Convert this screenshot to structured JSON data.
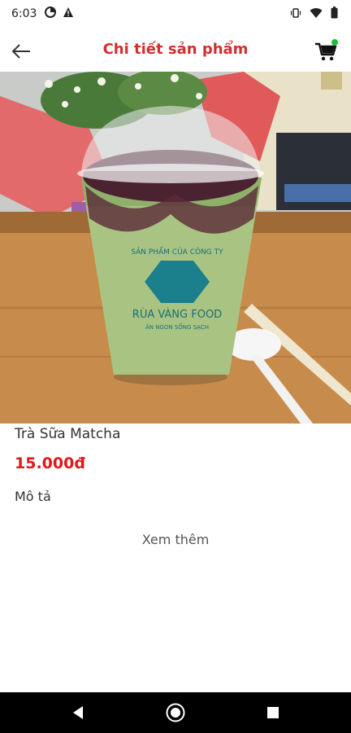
{
  "status": {
    "time": "6:03"
  },
  "header": {
    "title": "Chi tiết sản phẩm"
  },
  "product": {
    "name": "Trà Sữa Matcha",
    "price": "15.000đ",
    "cup_print_line1": "SẢN PHẨM CỦA CÔNG TY",
    "cup_print_line2": "RÙA VÀNG FOOD",
    "cup_print_line3": "ĂN NGON SỐNG SẠCH"
  },
  "description": {
    "label": "Mô tả",
    "see_more": "Xem thêm"
  },
  "colors": {
    "accent": "#d32f2f",
    "price": "#e0171b",
    "cart_badge": "#1fbf3a"
  },
  "icons": {
    "back": "arrow-left-icon",
    "cart": "cart-icon",
    "nav_back": "nav-back-icon",
    "nav_home": "nav-home-icon",
    "nav_recents": "nav-recents-icon"
  }
}
